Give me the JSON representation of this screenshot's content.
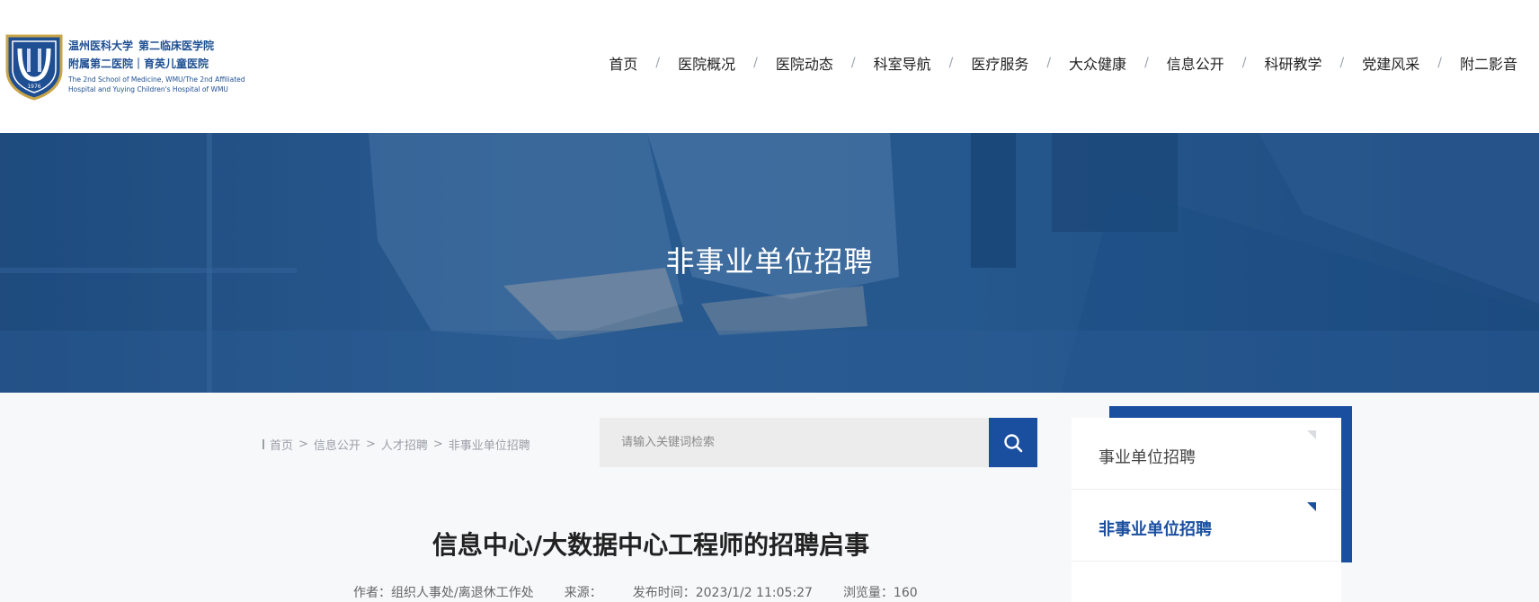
{
  "logo": {
    "line1_a": "温州医科大学",
    "line1_b": "第二临床医学院",
    "line2": "附属第二医院｜育英儿童医院",
    "en_line1": "The 2nd School of Medicine, WMU/The 2nd Affiliated",
    "en_line2": "Hospital and Yuying Children's Hospital of WMU",
    "badge_year": "1976"
  },
  "nav": {
    "items": [
      {
        "label": "首页"
      },
      {
        "label": "医院概况"
      },
      {
        "label": "医院动态"
      },
      {
        "label": "科室导航"
      },
      {
        "label": "医疗服务"
      },
      {
        "label": "大众健康"
      },
      {
        "label": "信息公开"
      },
      {
        "label": "科研教学"
      },
      {
        "label": "党建风采"
      },
      {
        "label": "附二影音"
      }
    ],
    "separator": "/"
  },
  "banner": {
    "title": "非事业单位招聘"
  },
  "breadcrumb": {
    "items": [
      "首页",
      "信息公开",
      "人才招聘",
      "非事业单位招聘"
    ],
    "separator": ">"
  },
  "search": {
    "placeholder": "请输入关键词检索",
    "icon": "search-icon"
  },
  "article": {
    "title": "信息中心/大数据中心工程师的招聘启事",
    "meta": {
      "author": "作者：组织人事处/离退休工作处",
      "source": "来源：",
      "published": "发布时间：2023/1/2 11:05:27",
      "views": "浏览量：160"
    }
  },
  "sidebar": {
    "items": [
      {
        "label": "事业单位招聘",
        "active": false
      },
      {
        "label": "非事业单位招聘",
        "active": true
      }
    ]
  },
  "colors": {
    "brand": "#1a4fa0",
    "banner": "#275b92"
  }
}
